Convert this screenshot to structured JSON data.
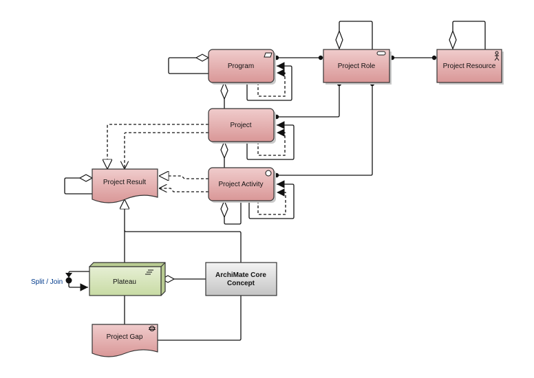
{
  "nodes": {
    "program": "Program",
    "project_role": "Project Role",
    "project_resource": "Project Resource",
    "project": "Project",
    "project_activity": "Project Activity",
    "project_result": "Project Result",
    "plateau": "Plateau",
    "core_concept_line1": "ArchiMate Core",
    "core_concept_line2": "Concept",
    "project_gap": "Project Gap"
  },
  "labels": {
    "split_join": "Split / Join"
  },
  "colors": {
    "work_package": "#d99a9a",
    "plateau": "#cfe0ad",
    "core": "#cccccc",
    "split_join_label": "#003a8c"
  },
  "icons": {
    "program": "work-package-icon",
    "project_role": "role-icon",
    "project_resource": "actor-icon",
    "project_activity": "event-icon",
    "plateau": "plateau-icon",
    "project_gap": "gap-icon"
  }
}
